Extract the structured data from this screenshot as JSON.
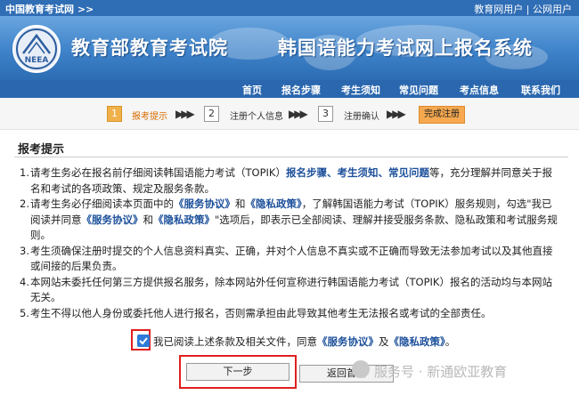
{
  "topbar": {
    "site": "中国教育考试网 >>",
    "links": [
      "教育网用户",
      "公网用户"
    ]
  },
  "banner": {
    "org": "教育部教育考试院",
    "system": "韩国语能力考试网上报名系统",
    "logo_text": "NEEA"
  },
  "nav": [
    "首页",
    "报名步骤",
    "考生须知",
    "常见问题",
    "考点信息",
    "联系我们"
  ],
  "steps": [
    {
      "num": "1",
      "label": "报考提示",
      "active": true
    },
    {
      "num": "2",
      "label": "注册个人信息",
      "active": false
    },
    {
      "num": "3",
      "label": "注册确认",
      "active": false
    }
  ],
  "steps_done": "完成注册",
  "heading": "报考提示",
  "rules": [
    {
      "n": "1.",
      "parts": [
        "请考生务必在报名前仔细阅读韩国语能力考试（TOPIK）",
        "报名步骤、考生须知、常见问题",
        "等，充分理解并同意关于报名和考试的各项政策、规定及服务条款。"
      ]
    },
    {
      "n": "2.",
      "parts": [
        "请考生务必仔细阅读本页面中的",
        "《服务协议》",
        "和",
        "《隐私政策》",
        "，了解韩国语能力考试（TOPIK）服务规则，勾选\"我已阅读并同意",
        "《服务协议》",
        "和",
        "《隐私政策》",
        "\"选项后，即表示已全部阅读、理解并接受服务条款、隐私政策和考试服务规则。"
      ]
    },
    {
      "n": "3.",
      "text": "考生须确保注册时提交的个人信息资料真实、正确，并对个人信息不真实或不正确而导致无法参加考试以及其他直接或间接的后果负责。"
    },
    {
      "n": "4.",
      "text": "本网站未委托任何第三方提供报名服务，除本网站外任何宣称进行韩国语能力考试（TOPIK）报名的活动均与本网站无关。"
    },
    {
      "n": "5.",
      "text": "考生不得以他人身份或委托他人进行报名，否则需承担由此导致其他考生无法报名或考试的全部责任。"
    }
  ],
  "agree": {
    "prefix": "我已阅读上述条款及相关文件，同意",
    "service": "《服务协议》",
    "mid": "及",
    "privacy": "《隐私政策》",
    "suffix": "。"
  },
  "buttons": {
    "next": "下一步",
    "home": "返回首页"
  },
  "watermark": "服务号 · 新通欧亚教育",
  "colors": {
    "header_blue": "#2f6db5",
    "nav_blue": "#2a67ae",
    "highlight": "#1b4f9a",
    "accent_orange": "#f6a94f",
    "annotation_red": "#e02020"
  }
}
